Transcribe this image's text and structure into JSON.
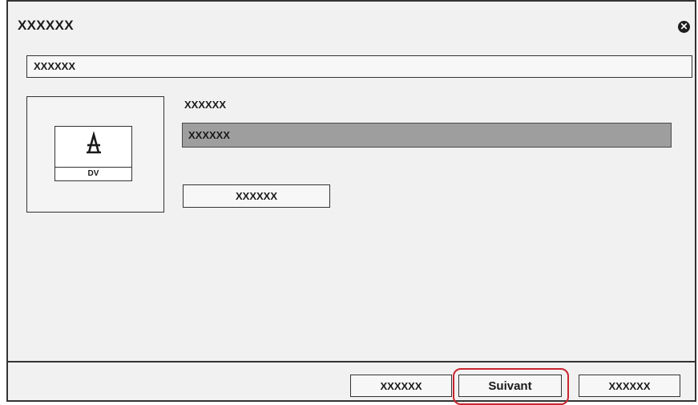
{
  "dialog": {
    "title": "XXXXXX",
    "close_icon": "close-icon"
  },
  "top_field": {
    "value": "XXXXXX"
  },
  "device": {
    "icon": "device-icon",
    "glyph": "A",
    "label": "DV"
  },
  "main": {
    "section_label": "XXXXXX",
    "selected_item": "XXXXXX",
    "action_button": "XXXXXX"
  },
  "footer": {
    "buttons": [
      {
        "label": "XXXXXX"
      },
      {
        "label": "Suivant"
      },
      {
        "label": "XXXXXX"
      }
    ]
  },
  "colors": {
    "highlight": "#c8262e",
    "selected_bar": "#9e9e9e"
  }
}
